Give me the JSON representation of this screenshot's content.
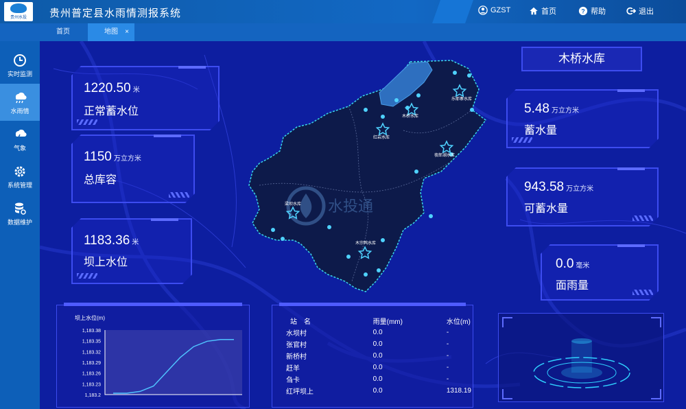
{
  "header": {
    "logo_text": "贵州水投",
    "title": "贵州普定县水雨情测报系统",
    "user": "GZST",
    "home": "首页",
    "help": "帮助",
    "logout": "退出"
  },
  "tabs": [
    {
      "label": "首页"
    },
    {
      "label": "地图",
      "close": "×"
    }
  ],
  "sidebar": {
    "items": [
      {
        "label": "实时监测",
        "icon": "clock-icon"
      },
      {
        "label": "水雨情",
        "icon": "rain-cloud-icon"
      },
      {
        "label": "气象",
        "icon": "thunder-cloud-icon"
      },
      {
        "label": "系统管理",
        "icon": "gear-icon"
      },
      {
        "label": "数据维护",
        "icon": "database-icon"
      }
    ]
  },
  "stats_left": [
    {
      "value": "1220.50",
      "unit": "米",
      "label": "正常蓄水位"
    },
    {
      "value": "1150",
      "unit": "万立方米",
      "label": "总库容"
    },
    {
      "value": "1183.36",
      "unit": "米",
      "label": "坝上水位"
    }
  ],
  "reservoir_name": "木桥水库",
  "stats_right": [
    {
      "value": "5.48",
      "unit": "万立方米",
      "label": "蓄水量"
    },
    {
      "value": "943.58",
      "unit": "万立方米",
      "label": "可蓄水量"
    },
    {
      "value": "0.0",
      "unit": "毫米",
      "label": "面雨量"
    }
  ],
  "map_markers": [
    "乐耶寨水库",
    "木桥水库",
    "红岩水库",
    "夜郎湖水库",
    "梁坝水库",
    "木宗鸭水库"
  ],
  "watermark": "水投通",
  "chart_data": {
    "type": "line",
    "title": "坝上水位(m)",
    "yticks": [
      "1,183.38",
      "1,183.35",
      "1,183.32",
      "1,183.29",
      "1,183.26",
      "1,183.23",
      "1,183.2"
    ],
    "ylim": [
      1183.2,
      1183.38
    ],
    "series": [
      {
        "values": [
          1183.2,
          1183.2,
          1183.205,
          1183.22,
          1183.26,
          1183.3,
          1183.33,
          1183.345,
          1183.35,
          1183.35
        ]
      }
    ],
    "grid": false,
    "colors": {
      "line": "#4fc3ff",
      "plot_bg": "#3a3fa8"
    }
  },
  "rain_table": {
    "headers": [
      "站　名",
      "雨量(mm)",
      "水位(m)"
    ],
    "rows": [
      [
        "水坝村",
        "0.0",
        "-"
      ],
      [
        "张官村",
        "0.0",
        "-"
      ],
      [
        "新桥村",
        "0.0",
        "-"
      ],
      [
        "赶羊",
        "0.0",
        "-"
      ],
      [
        "刍卡",
        "0.0",
        "-"
      ],
      [
        "红坪坝上",
        "0.0",
        "1318.19"
      ]
    ]
  },
  "colors": {
    "accent": "#3d4cf0",
    "map_bg": "#0d1ea0",
    "region": "#0d1a4a",
    "outline": "#3ad6e8"
  }
}
